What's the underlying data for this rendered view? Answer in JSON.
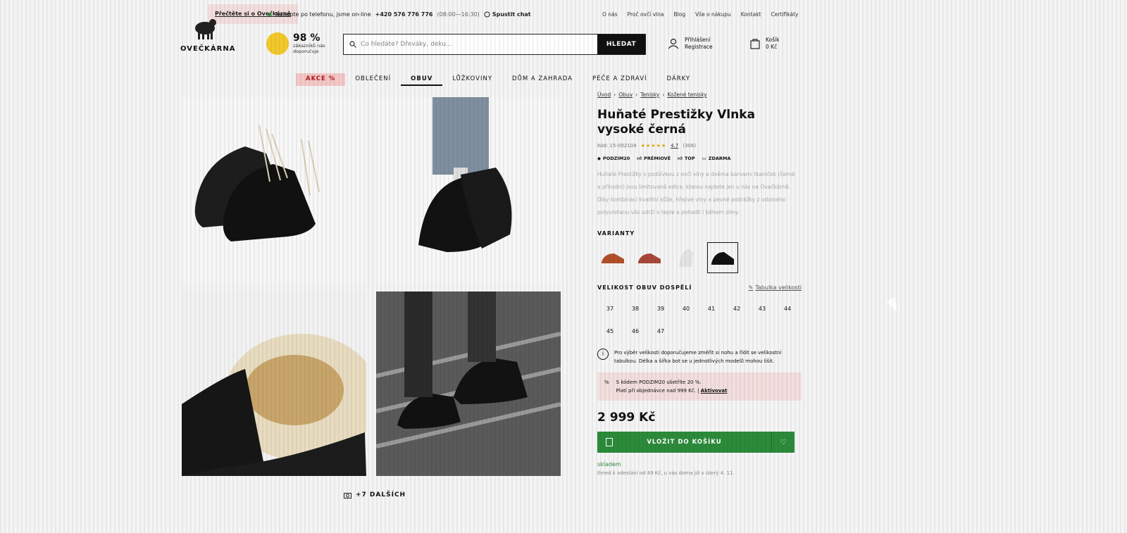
{
  "topbar": {
    "promo_link": "Přečtěte si o Ovečkárně",
    "phone_text": "Nakupte po telefonu, jsme on-line",
    "phone_number": "+420 576 776 776",
    "phone_hours": "(08:00—16:30)",
    "chat_label": "Spustit chat",
    "links": [
      "O nás",
      "Proč ovčí vlna",
      "Blog",
      "Vše o nákupu",
      "Kontakt",
      "Certifikáty"
    ]
  },
  "logo": {
    "name": "OVEČKÁRNA"
  },
  "rating": {
    "percent": "98 %",
    "label": "zákazníků nás doporučuje"
  },
  "search": {
    "placeholder": "Co hledáte? Dřeváky, deku...",
    "button": "HLEDAT"
  },
  "account": {
    "login": "Přihlášení",
    "register": "Registrace"
  },
  "cart": {
    "label": "Košík",
    "amount": "0 Kč"
  },
  "nav": [
    "AKCE %",
    "OBLEČENÍ",
    "OBUV",
    "LŮŽKOVINY",
    "DŮM A ZAHRADA",
    "PÉČE A ZDRAVÍ",
    "DÁRKY"
  ],
  "gallery": {
    "more_label": "+7 DALŠÍCH"
  },
  "breadcrumb": [
    "Úvod",
    "Obuv",
    "Tenisky",
    "Kožené tenisky"
  ],
  "product": {
    "title": "Huňaté Prestižky Vlnka vysoké černá",
    "code": "Kód: 15-002104",
    "rating_value": "4.7",
    "rating_count": "(306)",
    "tags": [
      "PODZIM20",
      "PRÉMIOVÉ",
      "TOP",
      "ZDARMA"
    ],
    "description": "Huňaté Prestižky s podšívkou z ovčí vlny a dvěma barvami tkaniček (černé a přírodní) jsou limitovaná edice, kterou najdete jen u nás na Ovečkárně. Díky kombinaci kvalitní kůže, hřejivé vlny a pevné podrážky z odolného polyuretanu vás udrží v teple a pohodlí i během zimy.",
    "variants_label": "VARIANTY",
    "size_label": "VELIKOST OBUV DOSPĚLÍ",
    "size_table_link": "Tabulka velikostí",
    "sizes": [
      "37",
      "38",
      "39",
      "40",
      "41",
      "42",
      "43",
      "44",
      "45",
      "46",
      "47"
    ],
    "size_notice": "Pro výběr velikosti doporučujeme změřit si nohu a řídit se velikostní tabulkou. Délka a šířka bot se u jednotlivých modelů mohou lišit.",
    "promo_line1": "S kódem PODZIM20 ušetříte 20 %.",
    "promo_line2": "Platí při objednávce nad 999 Kč.",
    "promo_action": "Aktivovat",
    "price": "2 999 Kč",
    "buy_label": "VLOŽIT DO KOŠÍKU",
    "stock": "skladem",
    "shipping": "Ihned k odeslání od 49 Kč, u vás doma již v úterý 4. 11."
  },
  "colors": {
    "accent_green": "#2c8b3a",
    "sale_red": "#b21c1c",
    "rating_yellow": "#f2c92b"
  }
}
